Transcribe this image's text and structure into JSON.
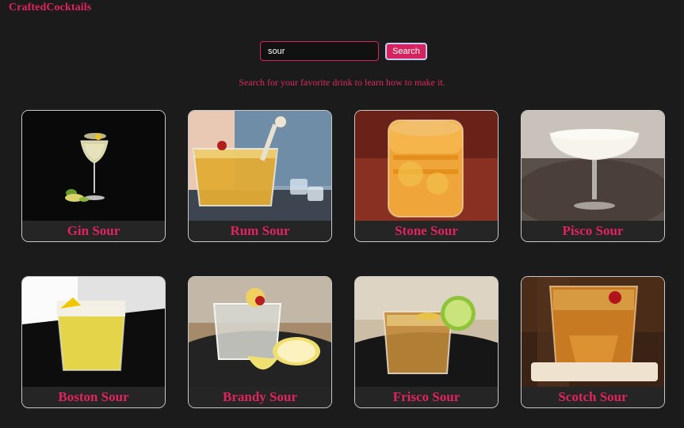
{
  "header": {
    "brand": "CraftedCocktails"
  },
  "search": {
    "value": "sour",
    "placeholder": "",
    "button_label": "Search"
  },
  "tagline": "Search for your favorite drink to learn how to make it.",
  "colors": {
    "background": "#1b1b1c",
    "accent": "#e0245e"
  },
  "drinks": [
    {
      "name": "Gin Sour"
    },
    {
      "name": "Rum Sour"
    },
    {
      "name": "Stone Sour"
    },
    {
      "name": "Pisco Sour"
    },
    {
      "name": "Boston Sour"
    },
    {
      "name": "Brandy Sour"
    },
    {
      "name": "Frisco Sour"
    },
    {
      "name": "Scotch Sour"
    }
  ]
}
